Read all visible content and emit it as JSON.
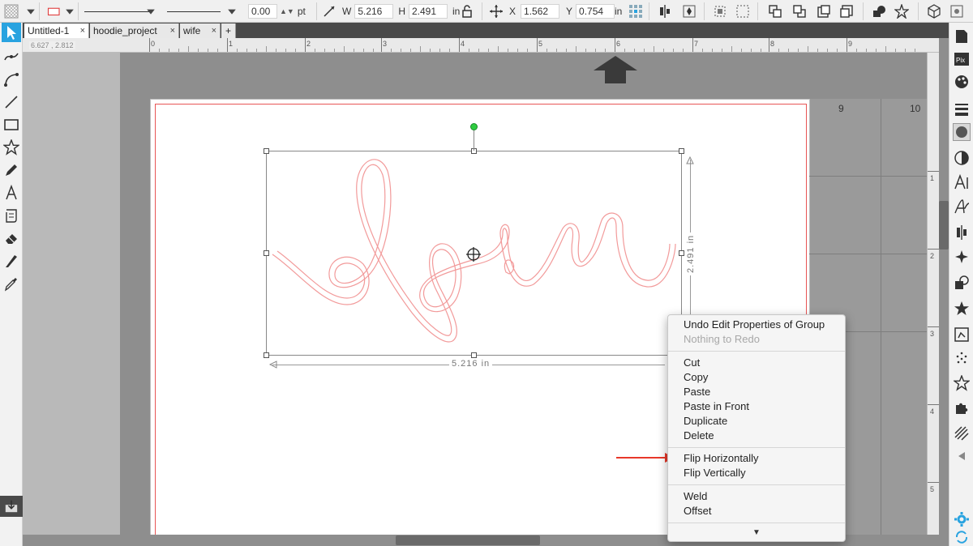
{
  "toolbar": {
    "line_width": "0.00",
    "line_unit": "pt",
    "width_label": "W",
    "width_value": "5.216",
    "height_label": "H",
    "height_value": "2.491",
    "size_unit": "in",
    "x_label": "X",
    "x_value": "1.562",
    "y_label": "Y",
    "y_value": "0.754",
    "pos_unit": "in"
  },
  "tabs": [
    {
      "label": "Untitled-1",
      "close": "×"
    },
    {
      "label": "hoodie_project",
      "close": "×"
    },
    {
      "label": "wife",
      "close": "×"
    },
    {
      "label": "+",
      "close": ""
    }
  ],
  "rulers": {
    "coord_readout": "6.627 , 2.812",
    "h_ticks": [
      "0",
      "1",
      "2",
      "3",
      "4",
      "5",
      "6",
      "7",
      "8",
      "9"
    ],
    "v_ticks": [
      "1",
      "2",
      "3",
      "4",
      "5"
    ],
    "mat_ticks": [
      "9",
      "10"
    ]
  },
  "selection": {
    "width_dim": "5.216 in",
    "height_dim": "2.491 in"
  },
  "context_menu": {
    "undo": "Undo Edit Properties of Group",
    "redo": "Nothing to Redo",
    "cut": "Cut",
    "copy": "Copy",
    "paste": "Paste",
    "paste_in_front": "Paste in Front",
    "duplicate": "Duplicate",
    "delete": "Delete",
    "flip_h": "Flip Horizontally",
    "flip_v": "Flip Vertically",
    "weld": "Weld",
    "offset": "Offset",
    "more": "▼"
  },
  "colors": {
    "accent": "#29a3e0",
    "cut_line": "#e85555",
    "arrow": "#e8382a",
    "rotate_handle": "#2ecc40"
  }
}
